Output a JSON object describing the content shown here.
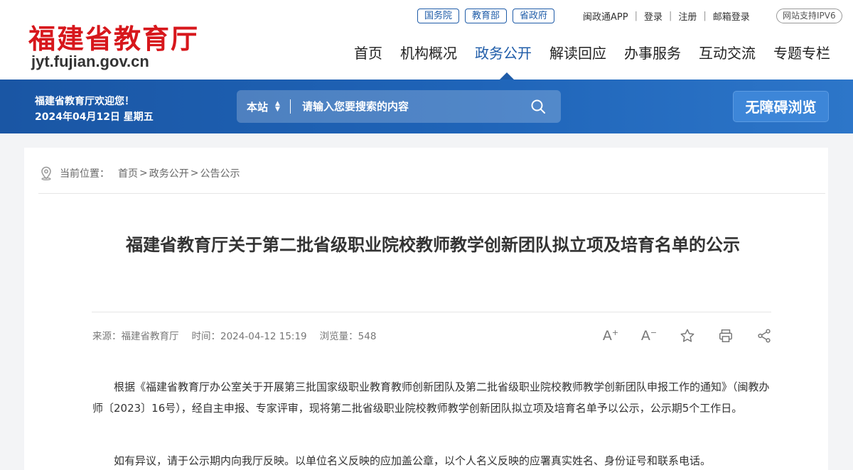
{
  "header": {
    "logo_cn": "福建省教育厅",
    "logo_en": "jyt.fujian.gov.cn",
    "gov_links": [
      "国务院",
      "教育部",
      "省政府"
    ],
    "top_links": [
      "闽政通APP",
      "登录",
      "注册",
      "邮箱登录"
    ],
    "ipv6": "网站支持IPV6",
    "nav": [
      "首页",
      "机构概况",
      "政务公开",
      "解读回应",
      "办事服务",
      "互动交流",
      "专题专栏"
    ],
    "active_nav": "政务公开"
  },
  "bluebar": {
    "welcome": "福建省教育厅欢迎您！",
    "date": "2024年04月12日 星期五",
    "search_scope": "本站",
    "search_placeholder": "请输入您要搜索的内容",
    "accessibility": "无障碍浏览"
  },
  "article": {
    "breadcrumb_label": "当前位置：",
    "breadcrumb": [
      "首页",
      "政务公开",
      "公告公示"
    ],
    "title": "福建省教育厅关于第二批省级职业院校教师教学创新团队拟立项及培育名单的公示",
    "meta": {
      "source": "来源：福建省教育厅",
      "time": "时间：2024-04-12 15:19",
      "views": "浏览量：548"
    },
    "tools": {
      "font_up": "A",
      "font_down": "A"
    },
    "paragraphs": [
      "根据《福建省教育厅办公室关于开展第三批国家级职业教育教师创新团队及第二批省级职业院校教师教学创新团队申报工作的通知》（闽教办师〔2023〕16号），经自主申报、专家评审，现将第二批省级职业院校教师教学创新团队拟立项及培育名单予以公示，公示期5个工作日。",
      "如有异议，请于公示期内向我厅反映。以单位名义反映的应加盖公章，以个人名义反映的应署真实姓名、身份证号和联系电话。"
    ]
  },
  "colors": {
    "brand_red": "#d7171c",
    "brand_blue": "#1f5ca8"
  }
}
